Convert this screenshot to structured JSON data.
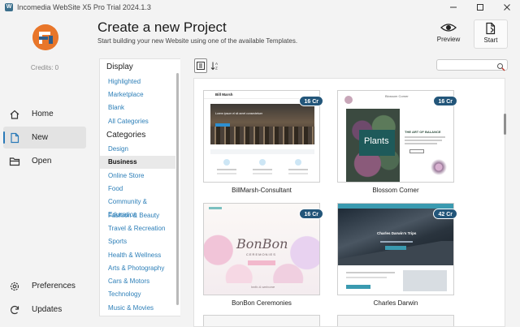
{
  "window": {
    "title": "Incomedia WebSite X5 Pro Trial 2024.1.3",
    "controls": [
      "minimize-icon",
      "maximize-icon",
      "close-icon"
    ]
  },
  "sidebar": {
    "credits": "Credits: 0",
    "items": [
      {
        "label": "Home",
        "icon": "home-icon"
      },
      {
        "label": "New",
        "icon": "new-file-icon",
        "active": true
      },
      {
        "label": "Open",
        "icon": "folder-icon"
      }
    ],
    "bottom": [
      {
        "label": "Preferences",
        "icon": "gear-icon"
      },
      {
        "label": "Updates",
        "icon": "refresh-icon"
      }
    ]
  },
  "header": {
    "title": "Create a new Project",
    "subtitle": "Start building your new Website using one of the available Templates.",
    "preview_label": "Preview",
    "start_label": "Start"
  },
  "categories": {
    "display_heading": "Display",
    "display_items": [
      "Highlighted",
      "Marketplace",
      "Blank",
      "All Categories"
    ],
    "categories_heading": "Categories",
    "category_items": [
      "Design",
      "Business",
      "Online Store",
      "Food",
      "Community & Education",
      "Fashion & Beauty",
      "Travel & Recreation",
      "Sports",
      "Health & Wellness",
      "Arts & Photography",
      "Cars & Motors",
      "Technology",
      "Music & Movies"
    ],
    "selected": "Business"
  },
  "templates": [
    {
      "name": "BillMarsh-Consultant",
      "credits": "16 Cr"
    },
    {
      "name": "Blossom Corner",
      "credits": "16 Cr"
    },
    {
      "name": "BonBon Ceremonies",
      "credits": "16 Cr"
    },
    {
      "name": "Charles Darwin",
      "credits": "42 Cr"
    }
  ],
  "thumb_text": {
    "bill_brand": "Bill Marsh",
    "bill_hero": "Lorem ipsum el sit amet consectetuer",
    "blossom_brand": "Blossom Corner",
    "blossom_plants": "Plants",
    "blossom_heading": "THE ART OF BALANCE",
    "bonbon_script": "BonBon",
    "bonbon_sub": "CEREMONIES",
    "bonbon_small": "hello & welcome",
    "darwin_hero": "Charles Darwin's Trips"
  },
  "colors": {
    "accent": "#2d7fb8",
    "badge": "#23567a",
    "logo_orange": "#e8762a",
    "logo_blue": "#2f5d8a"
  }
}
